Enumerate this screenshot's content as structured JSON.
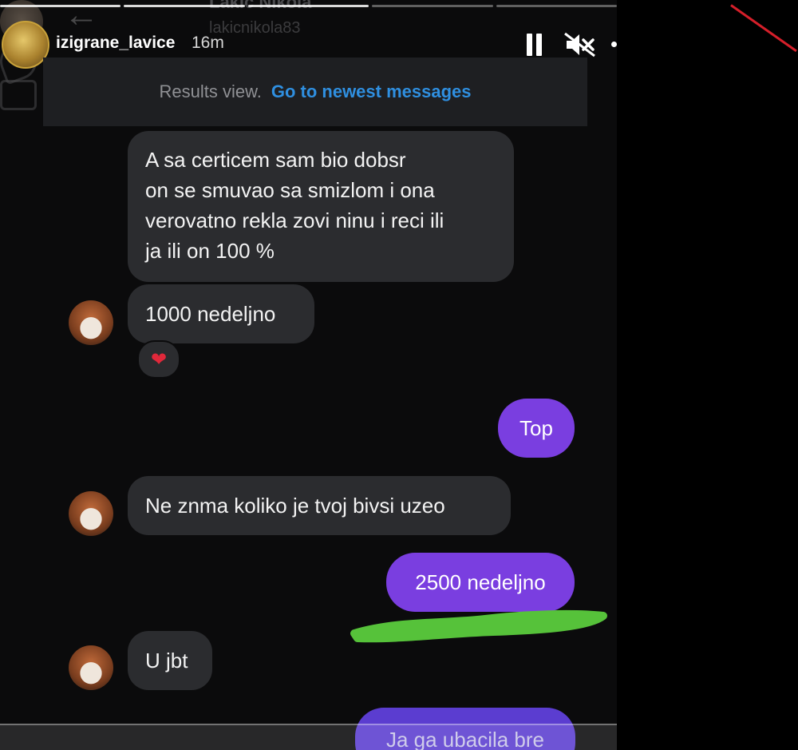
{
  "ghost_header": {
    "name": "Lakic Nikola",
    "handle": "lakicnikola83"
  },
  "story": {
    "username": "izigrane_lavice",
    "time_ago": "16m",
    "progress_segments": 5,
    "current_segment": 3
  },
  "banner": {
    "label": "Results view.",
    "link": "Go to newest messages"
  },
  "messages": [
    {
      "side": "incoming",
      "text": "A sa certicem sam bio dobsr\non se smuvao sa smizlom i ona\nverovatno rekla zovi ninu i reci ili\nja ili on 100 %"
    },
    {
      "side": "incoming",
      "text": "1000 nedeljno",
      "reaction": "❤"
    },
    {
      "side": "outgoing",
      "text": "Top"
    },
    {
      "side": "incoming",
      "text": "Ne znma koliko je tvoj bivsi uzeo"
    },
    {
      "side": "outgoing",
      "text": "2500 nedeljno"
    },
    {
      "side": "incoming",
      "text": "U jbt"
    },
    {
      "side": "outgoing",
      "text": "Ja ga ubacila bre"
    }
  ],
  "colors": {
    "background": "#0b0b0c",
    "incoming_bubble": "#2b2c2f",
    "outgoing_bubble": "#7a3ee0",
    "link": "#2f8fe0",
    "highlight_scribble": "#56c23a",
    "red_mark": "#d51f2a"
  },
  "icons": [
    "back-arrow-icon",
    "phone-icon",
    "video-icon",
    "pause-icon",
    "mute-icon",
    "more-icon",
    "heart-icon"
  ]
}
